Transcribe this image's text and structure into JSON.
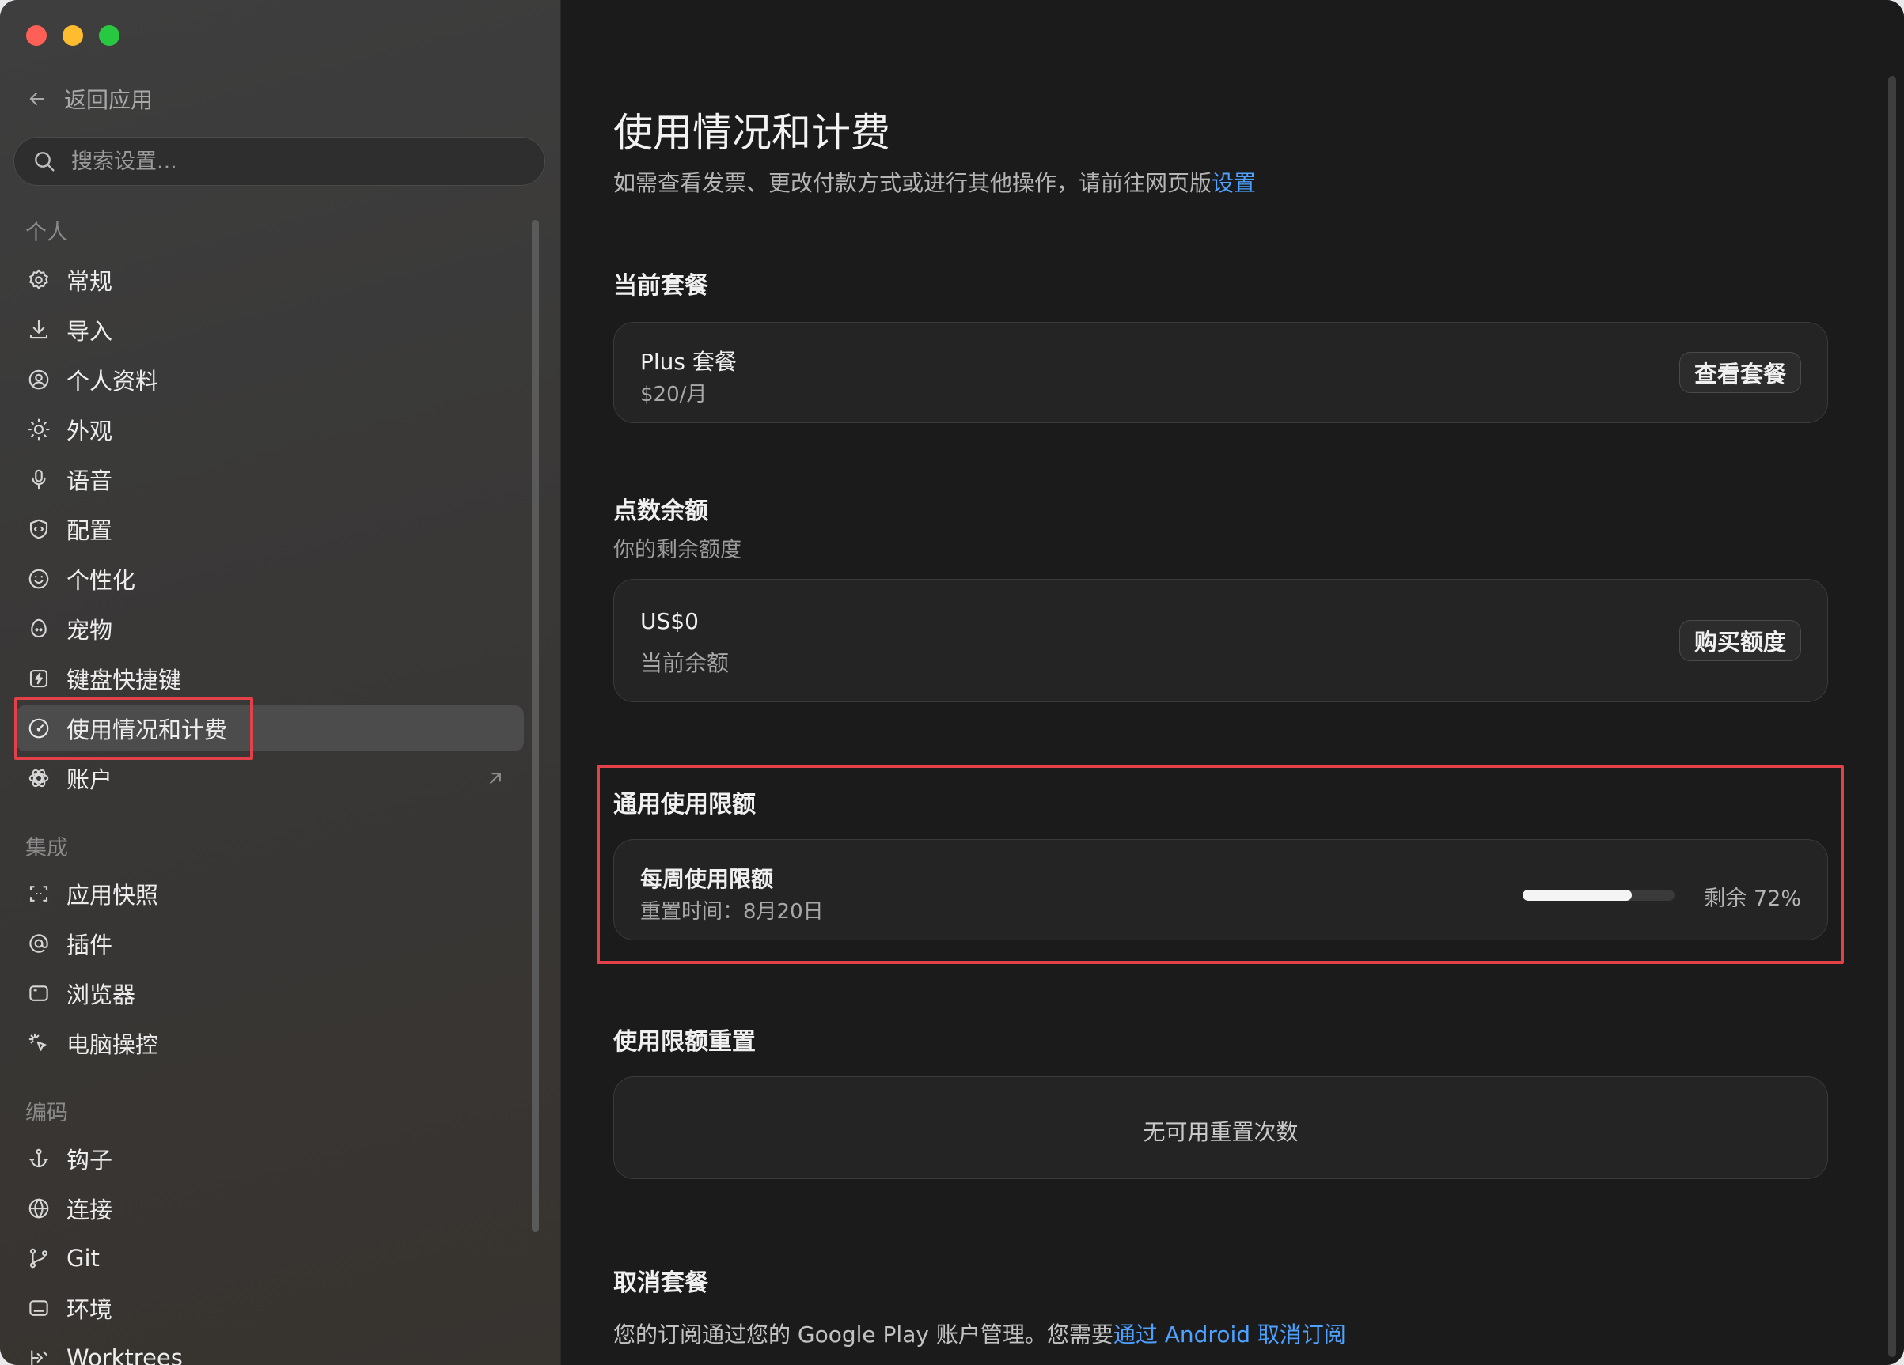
{
  "window": {
    "buttons": [
      "close",
      "minimize",
      "zoom"
    ]
  },
  "sidebar": {
    "back_label": "返回应用",
    "search_placeholder": "搜索设置...",
    "sections": [
      {
        "title": "个人",
        "items": [
          {
            "label": "常规",
            "icon": "gear-icon"
          },
          {
            "label": "导入",
            "icon": "download-icon"
          },
          {
            "label": "个人资料",
            "icon": "user-circle-icon"
          },
          {
            "label": "外观",
            "icon": "sun-icon"
          },
          {
            "label": "语音",
            "icon": "microphone-icon"
          },
          {
            "label": "配置",
            "icon": "shield-config-icon"
          },
          {
            "label": "个性化",
            "icon": "smile-icon"
          },
          {
            "label": "宠物",
            "icon": "pet-egg-icon"
          },
          {
            "label": "键盘快捷键",
            "icon": "keyboard-bolt-icon"
          },
          {
            "label": "使用情况和计费",
            "icon": "gauge-icon",
            "active": true
          },
          {
            "label": "账户",
            "icon": "openai-logo-icon",
            "external": true
          }
        ]
      },
      {
        "title": "集成",
        "items": [
          {
            "label": "应用快照",
            "icon": "screenshot-frame-icon"
          },
          {
            "label": "插件",
            "icon": "at-sign-icon"
          },
          {
            "label": "浏览器",
            "icon": "browser-window-icon"
          },
          {
            "label": "电脑操控",
            "icon": "cursor-click-icon"
          }
        ]
      },
      {
        "title": "编码",
        "items": [
          {
            "label": "钩子",
            "icon": "anchor-icon"
          },
          {
            "label": "连接",
            "icon": "globe-icon"
          },
          {
            "label": "Git",
            "icon": "git-branch-icon"
          },
          {
            "label": "环境",
            "icon": "terminal-window-icon"
          },
          {
            "label": "Worktrees",
            "icon": "worktree-icon"
          }
        ]
      }
    ]
  },
  "main": {
    "title": "使用情况和计费",
    "subtitle_text": "如需查看发票、更改付款方式或进行其他操作，请前往网页版",
    "subtitle_link": "设置",
    "current_plan": {
      "heading": "当前套餐",
      "plan_name": "Plus 套餐",
      "price": "$20/月",
      "button": "查看套餐"
    },
    "credits": {
      "heading": "点数余额",
      "description": "你的剩余额度",
      "amount": "US$0",
      "amount_label": "当前余额",
      "button": "购买额度"
    },
    "usage_limits": {
      "heading": "通用使用限额",
      "weekly_title": "每周使用限额",
      "reset_text": "重置时间：8月20日",
      "remaining_percent": 72,
      "remaining_text": "剩余 72%"
    },
    "limit_reset": {
      "heading": "使用限额重置",
      "empty_text": "无可用重置次数"
    },
    "cancel": {
      "heading": "取消套餐",
      "text": "您的订阅通过您的 Google Play 账户管理。您需要",
      "link": "通过 Android 取消订阅"
    }
  },
  "colors": {
    "accent_link": "#4ea1ff",
    "highlight_box": "#e3414a",
    "traffic_red": "#fe5f57",
    "traffic_yellow": "#febc2e",
    "traffic_green": "#28c840"
  }
}
